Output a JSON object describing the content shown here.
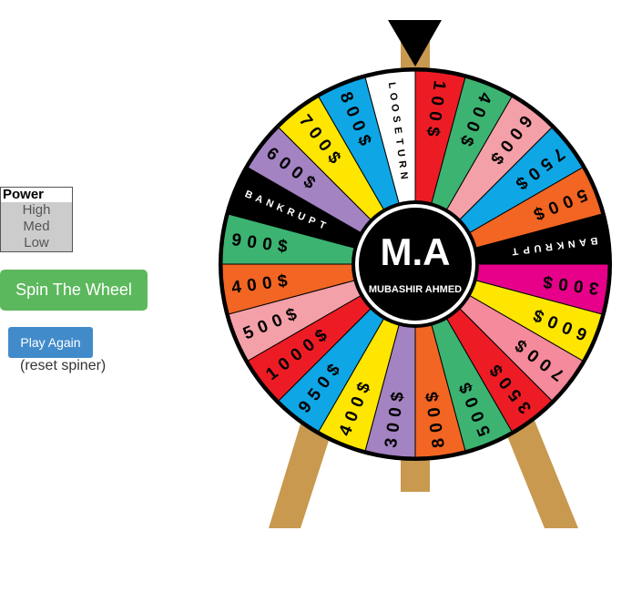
{
  "power": {
    "title": "Power",
    "options": [
      "High",
      "Med",
      "Low"
    ]
  },
  "buttons": {
    "spin": "Spin The Wheel",
    "play_again": "Play Again",
    "reset_note": "(reset spiner)"
  },
  "wheel": {
    "center_logo": "M.A",
    "center_name": "MUBASHIR AHMED",
    "segments": [
      {
        "label": "100$",
        "color": "#ed1c24"
      },
      {
        "label": "400$",
        "color": "#3cb371"
      },
      {
        "label": "600$",
        "color": "#f4a0a8"
      },
      {
        "label": "750$",
        "color": "#0fa6e5"
      },
      {
        "label": "500$",
        "color": "#f26522"
      },
      {
        "label": "BANKRUPT",
        "color": "#000000"
      },
      {
        "label": "300$",
        "color": "#e6008a"
      },
      {
        "label": "600$",
        "color": "#ffe600"
      },
      {
        "label": "700$",
        "color": "#f48a9b"
      },
      {
        "label": "350$",
        "color": "#ed1c24"
      },
      {
        "label": "500$",
        "color": "#3cb371"
      },
      {
        "label": "800$",
        "color": "#f26522"
      },
      {
        "label": "300$",
        "color": "#a483c2"
      },
      {
        "label": "400$",
        "color": "#ffe600"
      },
      {
        "label": "950$",
        "color": "#0fa6e5"
      },
      {
        "label": "1000$",
        "color": "#ed1c24"
      },
      {
        "label": "500$",
        "color": "#f4a0a8"
      },
      {
        "label": "400$",
        "color": "#f26522"
      },
      {
        "label": "900$",
        "color": "#3cb371"
      },
      {
        "label": "BANKRUPT",
        "color": "#000000"
      },
      {
        "label": "600$",
        "color": "#a483c2"
      },
      {
        "label": "700$",
        "color": "#ffe600"
      },
      {
        "label": "800$",
        "color": "#0fa6e5"
      },
      {
        "label": "LOOSE TURN",
        "color": "#ffffff"
      }
    ]
  },
  "colors": {
    "stand": "#c8994f",
    "spin_button": "#5cb85c",
    "play_button": "#428bca"
  }
}
